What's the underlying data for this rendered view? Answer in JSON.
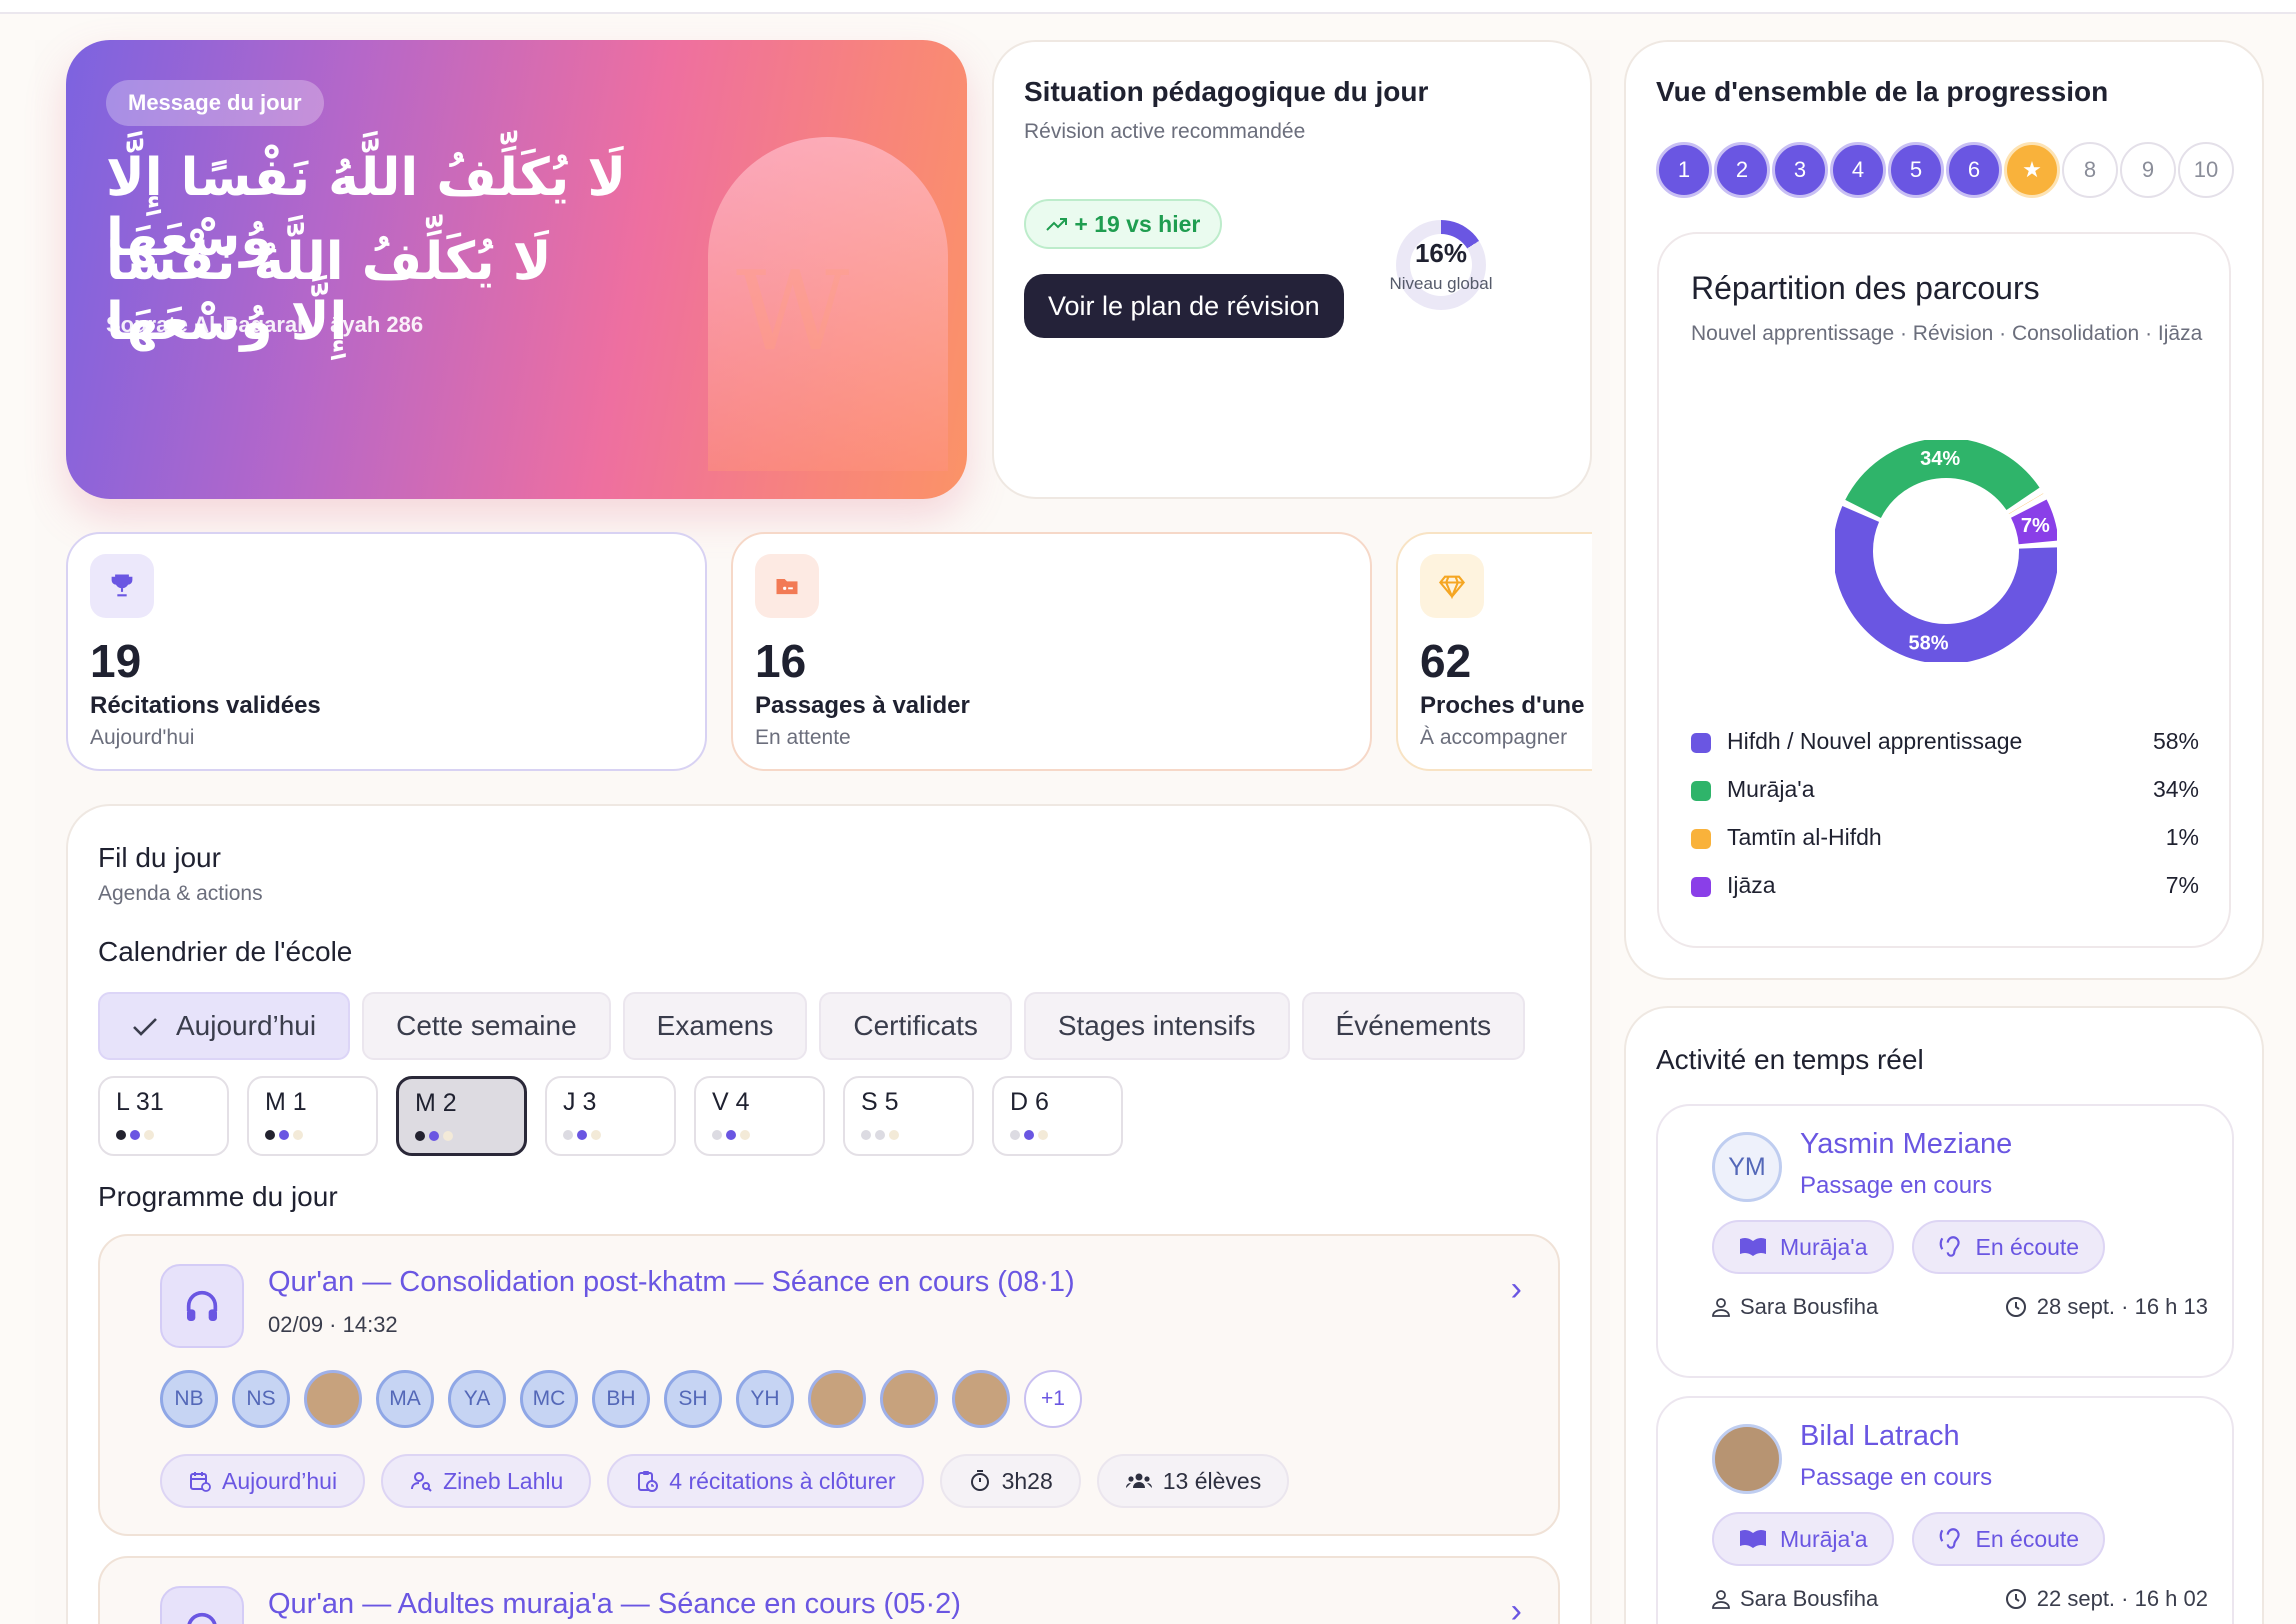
{
  "hero": {
    "badge": "Message du jour",
    "arabic_line1": "لَا يُكَلِّفُ اللَّهُ نَفْسًا إِلَّا وُسْعَهَا",
    "arabic_line2": "لَا يُكَلِّفُ اللَّهُ نَفْسًا إِلَّا وُسْعَهَا",
    "source": "Sourate Al-Baqarah · āyah 286"
  },
  "situation": {
    "title": "Situation pédagogique du jour",
    "subtitle": "Révision active recommandée",
    "trend": "+ 19 vs hier",
    "button": "Voir le plan de révision",
    "gauge_value": "16%",
    "gauge_percent": 16,
    "gauge_label": "Niveau global"
  },
  "stats": [
    {
      "value": "19",
      "label": "Récitations validées",
      "sub": "Aujourd'hui"
    },
    {
      "value": "16",
      "label": "Passages à valider",
      "sub": "En attente"
    },
    {
      "value": "62",
      "label": "Proches d'une da",
      "sub": "À accompagner"
    }
  ],
  "progression": {
    "title": "Vue d'ensemble de la progression",
    "steps": [
      "1",
      "2",
      "3",
      "4",
      "5",
      "6",
      "★",
      "8",
      "9",
      "10"
    ],
    "completed_steps": 6,
    "current_step": 7
  },
  "repartition": {
    "title": "Répartition des parcours",
    "subtitle": "Nouvel apprentissage · Révision · Consolidation · Ijāza",
    "legend": [
      {
        "name": "Hifdh / Nouvel apprentissage",
        "pct": "58%",
        "color": "#6a56e2"
      },
      {
        "name": "Murāja'a",
        "pct": "34%",
        "color": "#2fb46a"
      },
      {
        "name": "Tamtīn al-Hifdh",
        "pct": "1%",
        "color": "#f9b23b"
      },
      {
        "name": "Ijāza",
        "pct": "7%",
        "color": "#8a3fe8"
      }
    ]
  },
  "chart_data": {
    "type": "pie",
    "categories": [
      "Hifdh / Nouvel apprentissage",
      "Murāja'a",
      "Tamtīn al-Hifdh",
      "Ijāza"
    ],
    "values": [
      58,
      34,
      1,
      7
    ],
    "labels_shown": [
      "58%",
      "34%",
      "7%"
    ]
  },
  "fil": {
    "title": "Fil du jour",
    "subtitle": "Agenda & actions",
    "calendar_title": "Calendrier de l'école",
    "tabs": [
      "Aujourd’hui",
      "Cette semaine",
      "Examens",
      "Certificats",
      "Stages intensifs",
      "Événements"
    ],
    "days": [
      "L 31",
      "M 1",
      "M 2",
      "J 3",
      "V 4",
      "S 5",
      "D 6"
    ],
    "programme_title": "Programme du jour"
  },
  "sessions": [
    {
      "title": "Qur'an — Consolidation post-khatm — Séance en cours (08·1)",
      "date": "02/09 · 14:32",
      "avatars": [
        "NB",
        "NS",
        "",
        "MA",
        "YA",
        "MC",
        "BH",
        "SH",
        "YH",
        "",
        "",
        ""
      ],
      "more": "+1",
      "chips": [
        "Aujourd’hui",
        "Zineb Lahlu",
        "4 récitations à clôturer"
      ],
      "duration": "3h28",
      "students": "13 élèves"
    },
    {
      "title": "Qur'an — Adultes muraja'a — Séance en cours (05·2)"
    }
  ],
  "activity": {
    "title": "Activité en temps réel",
    "items": [
      {
        "initials": "YM",
        "name": "Yasmin Meziane",
        "status": "Passage en cours",
        "type": "Murāja'a",
        "state": "En écoute",
        "teacher": "Sara Bousfiha",
        "time": "28 sept. · 16 h 13"
      },
      {
        "initials": "",
        "name": "Bilal Latrach",
        "status": "Passage en cours",
        "type": "Murāja'a",
        "state": "En écoute",
        "teacher": "Sara Bousfiha",
        "time": "22 sept. · 16 h 02"
      }
    ]
  }
}
